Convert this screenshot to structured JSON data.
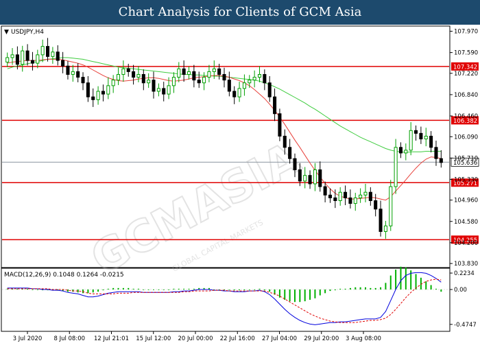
{
  "banner": {
    "title": "Chart Analysis for Clients of GCM Asia"
  },
  "colors": {
    "bull": "#00a000",
    "bear": "#000000",
    "ma_fast": "#e8403a",
    "ma_slow": "#3ecc3e",
    "level_line": "#e00000",
    "current_line": "#8c96a0",
    "macd_line": "#0000dd",
    "signal_line": "#e00000",
    "histogram": "#00b000",
    "banner_bg": "#1d4a6d"
  },
  "chart_data": [
    {
      "type": "candlestick",
      "title": "USDJPY,H4",
      "ylim": [
        103.77,
        108.05
      ],
      "y_ticks": [
        107.97,
        107.59,
        107.22,
        106.84,
        106.46,
        106.09,
        105.71,
        105.33,
        104.96,
        104.58,
        104.2,
        103.83
      ],
      "x_tick_labels": [
        "3 Jul 2020",
        "8 Jul 08:00",
        "12 Jul 21:01",
        "15 Jul 12:00",
        "20 Jul 00:00",
        "22 Jul 16:00",
        "27 Jul 04:00",
        "29 Jul 20:00",
        "3 Aug 08:00"
      ],
      "levels": [
        {
          "value": 107.342,
          "label": "107.342"
        },
        {
          "value": 106.382,
          "label": "106.382"
        },
        {
          "value": 105.271,
          "label": "105.271"
        },
        {
          "value": 104.255,
          "label": "104.255"
        }
      ],
      "current": {
        "value": 105.636,
        "label": "105.636"
      },
      "close": [
        107.5,
        107.55,
        107.38,
        107.62,
        107.45,
        107.4,
        107.55,
        107.7,
        107.52,
        107.6,
        107.45,
        107.35,
        107.2,
        107.25,
        107.15,
        107.05,
        106.8,
        106.75,
        106.9,
        106.85,
        107.0,
        107.1,
        107.2,
        107.3,
        107.25,
        107.15,
        107.2,
        107.05,
        107.1,
        106.9,
        106.95,
        106.85,
        107.0,
        107.15,
        107.3,
        107.2,
        107.25,
        107.1,
        107.05,
        107.15,
        107.25,
        107.3,
        107.2,
        107.1,
        106.9,
        106.8,
        106.95,
        107.05,
        107.1,
        107.15,
        107.2,
        107.05,
        106.8,
        106.5,
        106.1,
        105.9,
        105.7,
        105.5,
        105.3,
        105.4,
        105.25,
        105.5,
        105.2,
        105.05,
        105.0,
        104.95,
        105.1,
        105.0,
        104.9,
        105.0,
        105.05,
        105.1,
        104.95,
        104.8,
        104.4,
        104.5,
        105.2,
        105.9,
        105.8,
        105.85,
        106.2,
        106.15,
        106.05,
        106.1,
        105.9,
        105.7,
        105.63
      ],
      "ma_fast": [
        107.4,
        107.42,
        107.43,
        107.44,
        107.45,
        107.45,
        107.45,
        107.46,
        107.47,
        107.47,
        107.47,
        107.46,
        107.44,
        107.42,
        107.4,
        107.37,
        107.33,
        107.28,
        107.23,
        107.18,
        107.14,
        107.11,
        107.09,
        107.08,
        107.09,
        107.1,
        107.12,
        107.13,
        107.14,
        107.14,
        107.13,
        107.11,
        107.09,
        107.08,
        107.09,
        107.1,
        107.12,
        107.14,
        107.15,
        107.16,
        107.17,
        107.18,
        107.18,
        107.17,
        107.15,
        107.12,
        107.09,
        107.05,
        107.0,
        106.93,
        106.85,
        106.77,
        106.67,
        106.56,
        106.44,
        106.31,
        106.17,
        106.03,
        105.9,
        105.76,
        105.62,
        105.49,
        105.37,
        105.26,
        105.16,
        105.08,
        105.03,
        105.0,
        104.98,
        104.98,
        104.99,
        105.0,
        105.01,
        105.0,
        104.98,
        104.96,
        105.02,
        105.12,
        105.22,
        105.32,
        105.43,
        105.53,
        105.62,
        105.69,
        105.73,
        105.72,
        105.7
      ],
      "ma_slow": [
        107.3,
        107.33,
        107.35,
        107.37,
        107.39,
        107.41,
        107.43,
        107.45,
        107.47,
        107.48,
        107.49,
        107.5,
        107.5,
        107.49,
        107.48,
        107.47,
        107.45,
        107.43,
        107.41,
        107.39,
        107.37,
        107.35,
        107.33,
        107.32,
        107.31,
        107.3,
        107.29,
        107.28,
        107.27,
        107.26,
        107.25,
        107.24,
        107.23,
        107.22,
        107.21,
        107.2,
        107.2,
        107.19,
        107.19,
        107.18,
        107.18,
        107.17,
        107.17,
        107.16,
        107.15,
        107.14,
        107.13,
        107.12,
        107.11,
        107.1,
        107.08,
        107.05,
        107.02,
        106.98,
        106.94,
        106.89,
        106.84,
        106.79,
        106.74,
        106.69,
        106.63,
        106.58,
        106.52,
        106.46,
        106.4,
        106.34,
        106.28,
        106.23,
        106.18,
        106.13,
        106.08,
        106.04,
        106.0,
        105.96,
        105.92,
        105.88,
        105.85,
        105.83,
        105.82,
        105.81,
        105.82,
        105.82,
        105.82,
        105.83,
        105.83,
        105.83,
        105.83
      ]
    },
    {
      "type": "macd",
      "title": "MACD(12,26,9) 0.1048 0.1264 -0.0215",
      "ylim": [
        -0.56,
        0.28
      ],
      "y_ticks": [
        0.2234,
        0.0,
        -0.4747
      ],
      "macd": [
        0.02,
        0.02,
        0.02,
        0.02,
        0.02,
        0.01,
        0.01,
        0.0,
        0.0,
        -0.01,
        -0.01,
        -0.02,
        -0.04,
        -0.05,
        -0.06,
        -0.08,
        -0.1,
        -0.1,
        -0.09,
        -0.07,
        -0.05,
        -0.04,
        -0.03,
        -0.03,
        -0.03,
        -0.03,
        -0.03,
        -0.04,
        -0.04,
        -0.04,
        -0.04,
        -0.04,
        -0.04,
        -0.03,
        -0.03,
        -0.02,
        -0.02,
        -0.01,
        0.0,
        0.0,
        0.0,
        -0.01,
        -0.01,
        -0.02,
        -0.02,
        -0.03,
        -0.03,
        -0.03,
        -0.02,
        -0.02,
        -0.01,
        -0.03,
        -0.07,
        -0.13,
        -0.2,
        -0.27,
        -0.33,
        -0.38,
        -0.42,
        -0.45,
        -0.47,
        -0.48,
        -0.47,
        -0.46,
        -0.45,
        -0.45,
        -0.44,
        -0.44,
        -0.43,
        -0.42,
        -0.41,
        -0.4,
        -0.4,
        -0.4,
        -0.38,
        -0.3,
        -0.15,
        0.0,
        0.12,
        0.19,
        0.22,
        0.23,
        0.23,
        0.22,
        0.19,
        0.15,
        0.1
      ],
      "signal": [
        0.01,
        0.01,
        0.01,
        0.01,
        0.01,
        0.01,
        0.01,
        0.01,
        0.01,
        0.0,
        0.0,
        0.0,
        -0.01,
        -0.02,
        -0.02,
        -0.03,
        -0.05,
        -0.06,
        -0.06,
        -0.06,
        -0.06,
        -0.06,
        -0.05,
        -0.05,
        -0.05,
        -0.04,
        -0.04,
        -0.04,
        -0.04,
        -0.04,
        -0.04,
        -0.04,
        -0.04,
        -0.04,
        -0.04,
        -0.03,
        -0.03,
        -0.02,
        -0.02,
        -0.02,
        -0.02,
        -0.01,
        -0.01,
        -0.01,
        -0.02,
        -0.02,
        -0.02,
        -0.02,
        -0.02,
        -0.02,
        -0.02,
        -0.02,
        -0.04,
        -0.06,
        -0.09,
        -0.13,
        -0.17,
        -0.21,
        -0.25,
        -0.29,
        -0.33,
        -0.36,
        -0.39,
        -0.41,
        -0.43,
        -0.44,
        -0.45,
        -0.45,
        -0.45,
        -0.45,
        -0.44,
        -0.43,
        -0.42,
        -0.42,
        -0.41,
        -0.39,
        -0.34,
        -0.27,
        -0.19,
        -0.11,
        -0.04,
        0.02,
        0.07,
        0.11,
        0.13,
        0.14,
        0.13
      ]
    }
  ]
}
